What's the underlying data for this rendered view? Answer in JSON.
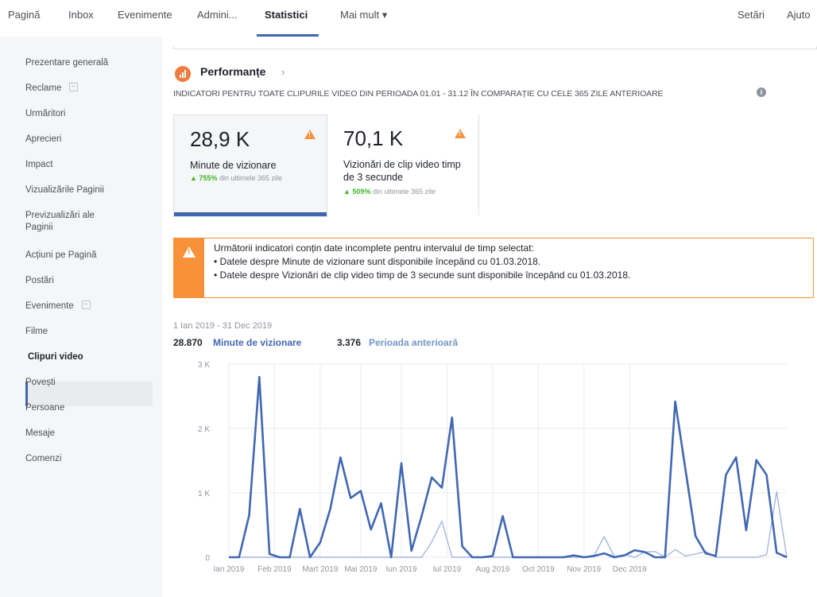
{
  "nav": {
    "items": [
      "Pagină",
      "Inbox",
      "Evenimente",
      "Admini...",
      "Statistici",
      "Mai mult ▾"
    ],
    "right": [
      "Setări",
      "Ajuto"
    ]
  },
  "sidebar": {
    "items": [
      {
        "label": "Prezentare generală"
      },
      {
        "label": "Reclame"
      },
      {
        "label": "Urmăritori"
      },
      {
        "label": "Aprecieri"
      },
      {
        "label": "Impact"
      },
      {
        "label": "Vizualizările Paginii"
      },
      {
        "label": "Previzualizări ale Paginii"
      },
      {
        "label": "Acțiuni pe Pagină"
      },
      {
        "label": "Postări"
      },
      {
        "label": "Evenimente"
      },
      {
        "label": "Filme"
      },
      {
        "label": "Clipuri video"
      },
      {
        "label": "Povești"
      },
      {
        "label": "Persoane"
      },
      {
        "label": "Mesaje"
      },
      {
        "label": "Comenzi"
      }
    ],
    "active": "Clipuri video"
  },
  "performance": {
    "title": "Performanțe",
    "chevron": "›",
    "subtitle": "INDICATORI PENTRU TOATE CLIPURILE VIDEO DIN PERIOADA 01.01 - 31.12 ÎN COMPARAȚIE CU CELE 365 ZILE ANTERIOARE",
    "info": "i"
  },
  "cards": [
    {
      "value": "28,9 K",
      "label": "Minute de vizionare",
      "delta_pct": "755%",
      "delta_text": " din ultimele 365 zile"
    },
    {
      "value": "70,1 K",
      "label": "Vizionări de clip video timp de 3 secunde",
      "delta_pct": "509%",
      "delta_text": " din ultimele 365 zile"
    }
  ],
  "warning": {
    "intro": "Următorii indicatori conțin date incomplete pentru intervalul de timp selectat:",
    "line1": "• Datele despre Minute de vizionare sunt disponibile începând cu 01.03.2018.",
    "line2": "• Datele despre Vizionări de clip video timp de 3 secunde sunt disponibile începând cu 01.03.2018."
  },
  "colors": {
    "accent": "#4267b2",
    "previous": "#a3b7e0",
    "warning": "#f7923a",
    "up": "#42b72a"
  },
  "chart_data": {
    "type": "line",
    "date_range": "1 Ian 2019 - 31 Dec 2019",
    "legend": [
      {
        "total": "28.870",
        "name": "Minute de vizionare"
      },
      {
        "total": "3.376",
        "name": "Perioada anterioară"
      }
    ],
    "y_ticks": [
      "0",
      "1 K",
      "2 K",
      "3 K"
    ],
    "ylim": [
      0,
      3000
    ],
    "x_labels": [
      "Ian 2019",
      "Feb 2019",
      "Mart 2019",
      "Mai 2019",
      "Iun 2019",
      "Iul 2019",
      "Aug 2019",
      "Oct 2019",
      "Nov 2019",
      "Dec 2019"
    ],
    "x_label_weeks": [
      0,
      4.5,
      9,
      13,
      17,
      21.5,
      26,
      30.5,
      35,
      39.5
    ],
    "series": [
      {
        "name": "Minute de vizionare",
        "values": [
          0,
          0,
          650,
          2800,
          50,
          0,
          0,
          750,
          0,
          230,
          750,
          1550,
          920,
          1030,
          430,
          840,
          0,
          1460,
          100,
          640,
          1240,
          1080,
          2170,
          170,
          0,
          0,
          20,
          640,
          0,
          0,
          0,
          0,
          0,
          0,
          30,
          0,
          20,
          60,
          0,
          30,
          110,
          80,
          0,
          0,
          2420,
          1370,
          330,
          60,
          20,
          1280,
          1550,
          420,
          1510,
          1280,
          70,
          0
        ]
      },
      {
        "name": "Perioada anterioară",
        "values": [
          0,
          0,
          0,
          0,
          0,
          0,
          0,
          0,
          0,
          0,
          0,
          0,
          0,
          0,
          0,
          0,
          0,
          0,
          0,
          0,
          240,
          560,
          0,
          0,
          0,
          0,
          0,
          0,
          0,
          0,
          0,
          0,
          0,
          0,
          0,
          0,
          30,
          320,
          10,
          40,
          0,
          80,
          90,
          0,
          120,
          20,
          50,
          90,
          0,
          0,
          0,
          0,
          0,
          40,
          1020,
          0
        ]
      }
    ]
  }
}
